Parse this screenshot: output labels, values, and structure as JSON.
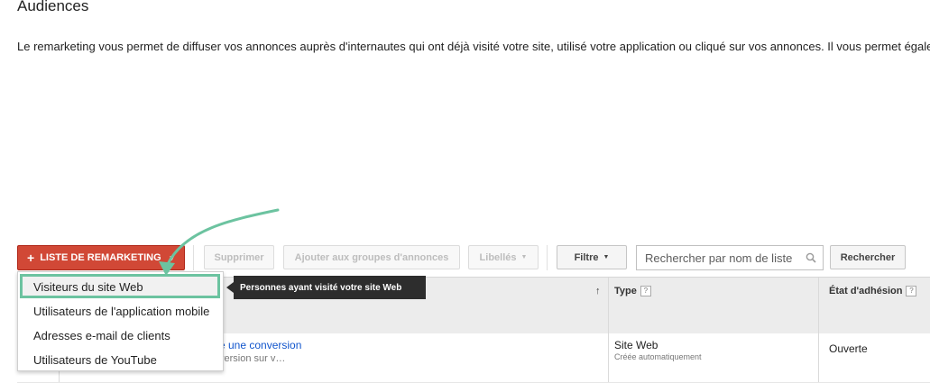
{
  "page": {
    "title": "Audiences",
    "description": "Le remarketing vous permet de diffuser vos annonces auprès d'internautes qui ont déjà visité votre site, utilisé votre application ou cliqué sur vos annonces. Il vous permet égale"
  },
  "toolbar": {
    "remarketing_label": "LISTE DE REMARKETING",
    "delete_label": "Supprimer",
    "add_to_groups_label": "Ajouter aux groupes d'annonces",
    "labels_label": "Libellés",
    "filter_label": "Filtre",
    "search_placeholder": "Rechercher par nom de liste",
    "search_button_label": "Rechercher"
  },
  "dropdown": {
    "items": [
      "Visiteurs du site Web",
      "Utilisateurs de l'application mobile",
      "Adresses e-mail de clients",
      "Utilisateurs de YouTube"
    ]
  },
  "tooltip": {
    "text": "Personnes ayant visité votre site Web"
  },
  "table": {
    "headers": {
      "type": "Type",
      "state": "État d'adhésion",
      "help": "?"
    },
    "row": {
      "name_link": "é une conversion",
      "name_sub": "version sur v…",
      "type": "Site Web",
      "type_sub": "Créée automatiquement",
      "state": "Ouverte"
    }
  },
  "colors": {
    "accent_red": "#d14836",
    "highlight_green": "#6cc3a0",
    "link_blue": "#1155cc",
    "tooltip_bg": "#2d2d2d"
  }
}
